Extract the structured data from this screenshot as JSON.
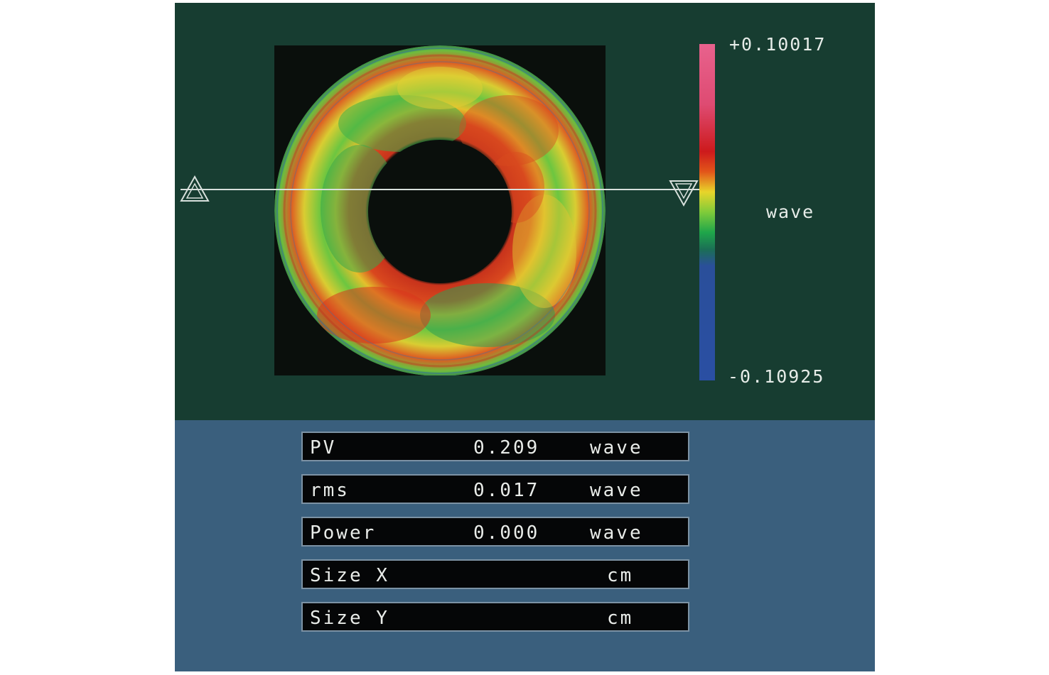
{
  "colorbar": {
    "max_label": "+0.10017",
    "min_label": "-0.10925",
    "unit_label": "wave",
    "colors": [
      "#e8628d",
      "#cd1a1c",
      "#e8d52a",
      "#1fa64a",
      "#2a4fa3"
    ]
  },
  "markers": {
    "left_icon": "up-triangle-icon",
    "right_icon": "down-triangle-icon"
  },
  "stats": [
    {
      "label": "PV",
      "value": "0.209",
      "unit": "wave"
    },
    {
      "label": "rms",
      "value": "0.017",
      "unit": "wave"
    },
    {
      "label": "Power",
      "value": "0.000",
      "unit": "wave"
    },
    {
      "label": "Size X",
      "value": "",
      "unit": "cm"
    },
    {
      "label": "Size Y",
      "value": "",
      "unit": "cm"
    }
  ]
}
